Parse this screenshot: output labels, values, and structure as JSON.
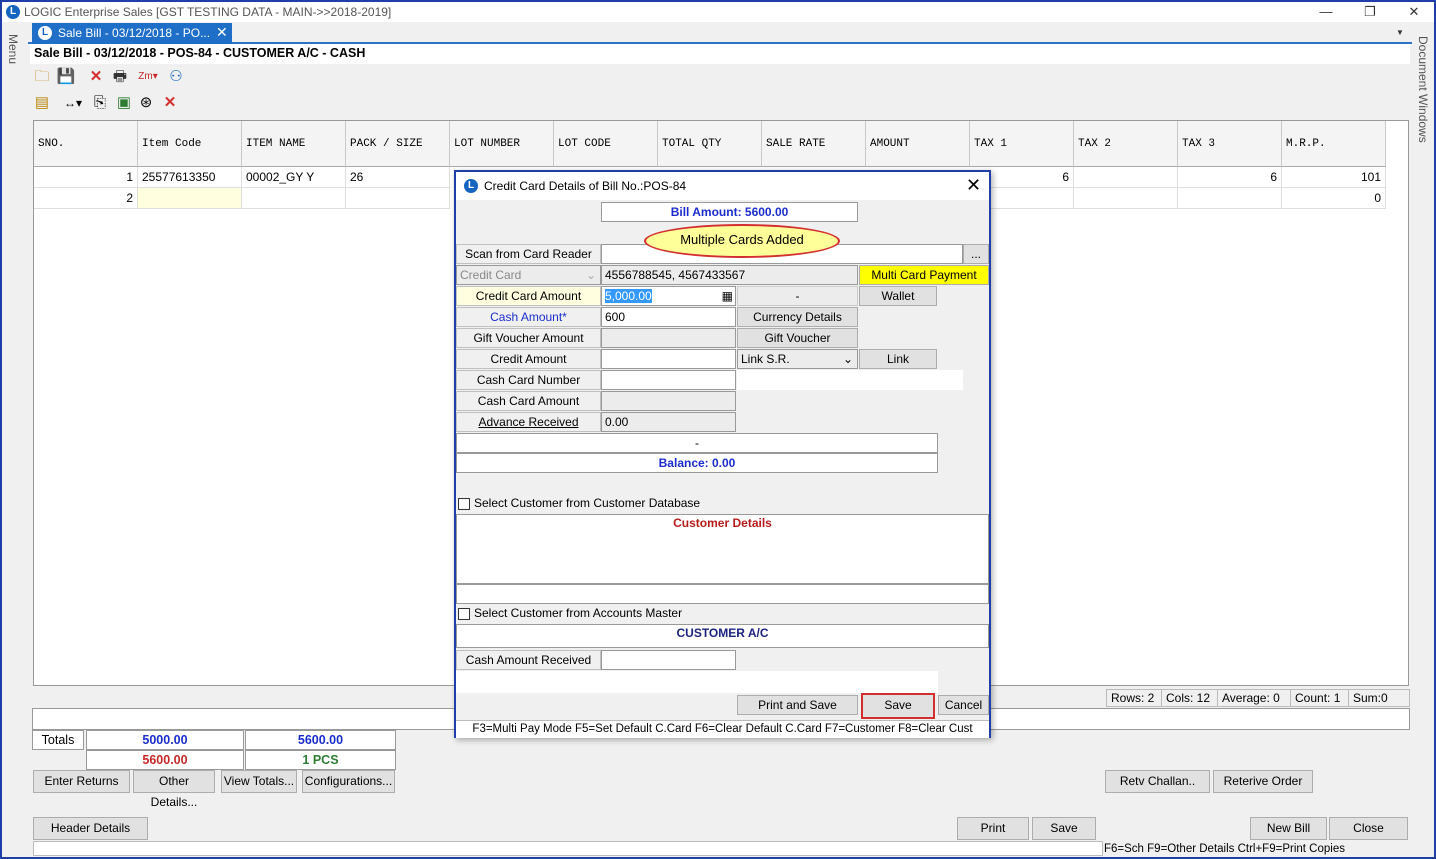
{
  "window": {
    "title": "LOGIC Enterprise Sales  [GST TESTING DATA - MAIN->>2018-2019]",
    "minimize": "—",
    "maximize": "❐",
    "close": "✕"
  },
  "side": {
    "left_label": "Menu",
    "right_label": "Document Windows"
  },
  "tab": {
    "label": "Sale Bill - 03/12/2018 - PO...",
    "close": "✕"
  },
  "doc_header": "Sale Bill - 03/12/2018 - POS-84 - CUSTOMER A/C - CASH",
  "grid": {
    "headers": [
      "SNO.",
      "Item Code",
      "ITEM NAME",
      "PACK / SIZE",
      "LOT NUMBER",
      "LOT CODE",
      "TOTAL QTY",
      "SALE RATE",
      "AMOUNT",
      "TAX 1",
      "TAX 2",
      "TAX 3",
      "M.R.P."
    ],
    "rows": [
      {
        "sno": "1",
        "item_code": "25577613350",
        "item_name": "00002_GY Y",
        "pack": "26",
        "tax1": "6",
        "tax3": "6",
        "mrp": "101"
      },
      {
        "sno": "2",
        "item_code": "",
        "item_name": "",
        "pack": "",
        "tax1": "",
        "tax3": "",
        "mrp": "0"
      }
    ]
  },
  "status": {
    "rows": "Rows: 2",
    "cols": "Cols: 12",
    "average": "Average: 0",
    "count": "Count: 1",
    "sum": "Sum:0"
  },
  "totals": {
    "label": "Totals",
    "amount1": "5000.00",
    "amount2": "5600.00",
    "amount3": "5600.00",
    "qty": "1 PCS",
    "color_blue": "#1a2dcc",
    "color_red": "#c62828",
    "color_green": "#2e7d32"
  },
  "buttons": {
    "enter_returns": "Enter Returns",
    "other_details": "Other Details...",
    "view_totals": "View Totals...",
    "configurations": "Configurations...",
    "retv_challan": "Retv Challan..",
    "retrieve_order": "Reterive Order",
    "header_details": "Header Details",
    "print": "Print",
    "save": "Save",
    "new_bill": "New Bill",
    "close": "Close"
  },
  "hint": "F6=Sch  F9=Other Details  Ctrl+F9=Print Copies",
  "dialog": {
    "title": "Credit Card Details of Bill No.:POS-84",
    "bill_amount": "Bill Amount: 5600.00",
    "callout": "Multiple Cards Added",
    "scan_label": "Scan from Card Reader",
    "scan_btn": "...",
    "card_type": "Credit Card",
    "card_numbers": "4556788545, 4567433567",
    "multi_card_btn": "Multi Card Payment",
    "credit_card_amount_label": "Credit Card Amount",
    "credit_card_amount": "5,000.00",
    "dash": "-",
    "wallet_btn": "Wallet",
    "cash_amount_label": "Cash Amount*",
    "cash_amount": "600",
    "currency_btn": "Currency Details",
    "gift_voucher_amount_label": "Gift Voucher Amount",
    "gift_voucher_btn": "Gift Voucher",
    "credit_amount_label": "Credit Amount",
    "link_select": "Link S.R.",
    "link_btn": "Link",
    "cash_card_number_label": "Cash Card Number",
    "cash_card_amount_label": "Cash Card Amount",
    "advance_label": "Advance Received",
    "advance_value": "0.00",
    "sep_dash": "-",
    "balance": "Balance: 0.00",
    "select_customer_db": "Select Customer from Customer Database",
    "customer_details": "Customer Details",
    "select_accounts": "Select Customer from Accounts Master",
    "customer_ac": "CUSTOMER A/C",
    "cash_received_label": "Cash Amount Received",
    "print_save_btn": "Print and Save",
    "save_btn": "Save",
    "cancel_btn": "Cancel",
    "shortcuts": "F3=Multi Pay Mode  F5=Set Default C.Card   F6=Clear Default C.Card   F7=Customer  F8=Clear Cust"
  }
}
